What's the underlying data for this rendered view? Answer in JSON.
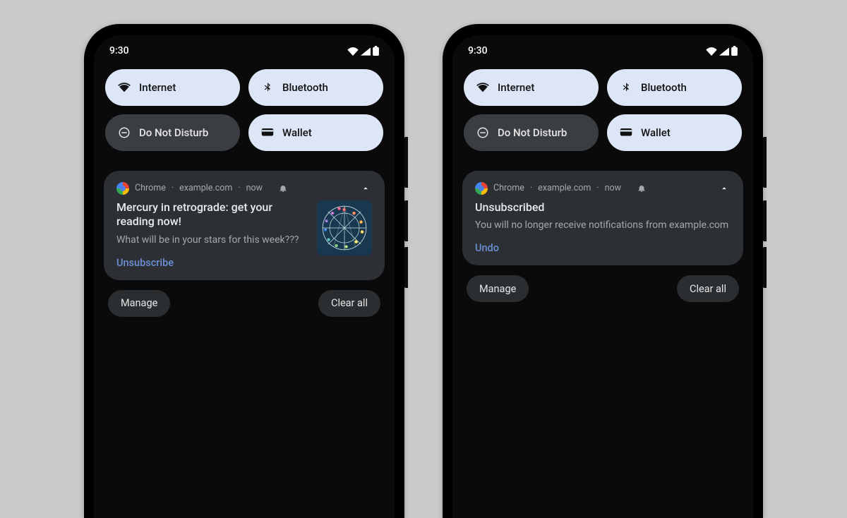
{
  "status": {
    "time": "9:30"
  },
  "tiles": {
    "internet": "Internet",
    "bluetooth": "Bluetooth",
    "dnd": "Do Not Disturb",
    "wallet": "Wallet"
  },
  "notif_common": {
    "app": "Chrome",
    "site": "example.com",
    "time": "now",
    "sep": " · "
  },
  "phone_left": {
    "notif": {
      "title": "Mercury in retrograde: get your reading now!",
      "subtitle": "What will be in your stars for this week???",
      "action": "Unsubscribe"
    }
  },
  "phone_right": {
    "notif": {
      "title": "Unsubscribed",
      "subtitle": "You will no longer receive notifications from example.com",
      "action": "Undo"
    }
  },
  "chips": {
    "manage": "Manage",
    "clear_all": "Clear all"
  }
}
